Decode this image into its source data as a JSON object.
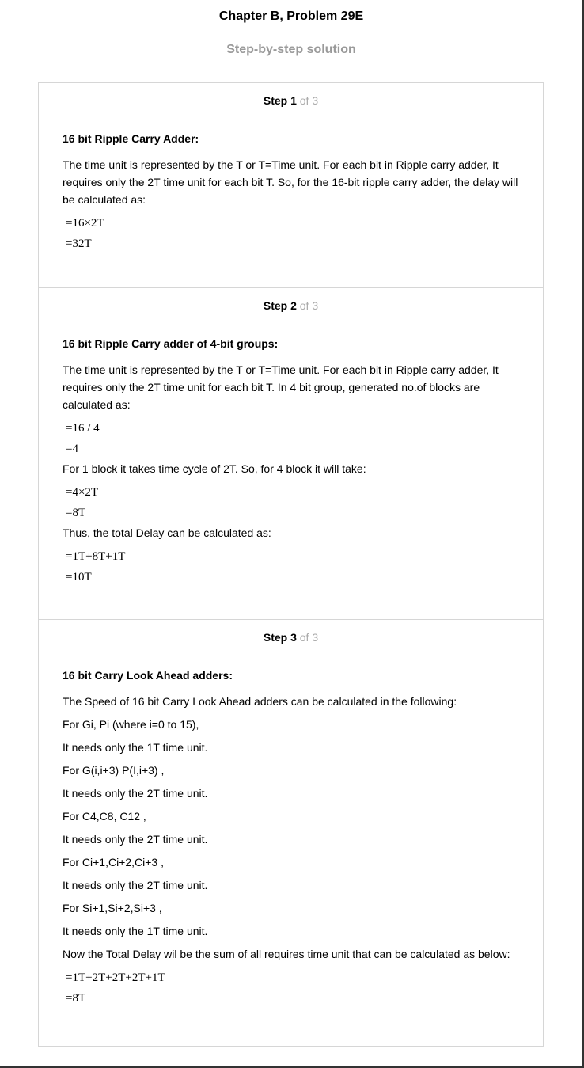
{
  "title": "Chapter B, Problem 29E",
  "subtitle": "Step-by-step solution",
  "steps": [
    {
      "step_label": "Step 1",
      "of_label": "of 3",
      "heading": "16 bit Ripple Carry Adder:",
      "paragraphs": [
        "The time unit is represented by the T or T=Time unit. For each bit in Ripple carry adder, It requires only the 2T time unit for each bit T. So, for the 16-bit ripple carry adder, the delay will be calculated as:"
      ],
      "math": [
        "=16×2T",
        "=32T"
      ]
    },
    {
      "step_label": "Step 2",
      "of_label": "of 3",
      "heading": "16 bit Ripple Carry adder of 4-bit groups:",
      "p1": "The time unit is represented by the T or T=Time unit. For each bit in Ripple carry adder, It requires only the 2T time unit for each bit T. In 4 bit group, generated no.of blocks are calculated as:",
      "m1": [
        "=16 / 4",
        "=4"
      ],
      "p2": "For 1 block it takes time cycle of 2T. So, for 4 block it will take:",
      "m2": [
        "=4×2T",
        "=8T"
      ],
      "p3": "Thus, the total Delay can be calculated as:",
      "m3": [
        "=1T+8T+1T",
        "=10T"
      ]
    },
    {
      "step_label": "Step 3",
      "of_label": "of 3",
      "heading": "16 bit Carry Look Ahead adders:",
      "lines": [
        "The Speed of 16 bit Carry Look Ahead adders can be calculated in the following:",
        "For Gi, Pi (where i=0 to 15),",
        "It needs only the 1T time unit.",
        "For G(i,i+3) P(I,i+3) ,",
        "It needs only the 2T time unit.",
        "For C4,C8, C12 ,",
        "It needs only the 2T time unit.",
        "For Ci+1,Ci+2,Ci+3 ,",
        "It needs only the 2T time unit.",
        "For Si+1,Si+2,Si+3 ,",
        "It needs only the 1T time unit.",
        "Now the Total Delay wil be the sum of all requires time unit that can be calculated as below:"
      ],
      "math": [
        "=1T+2T+2T+2T+1T",
        "=8T"
      ]
    }
  ]
}
